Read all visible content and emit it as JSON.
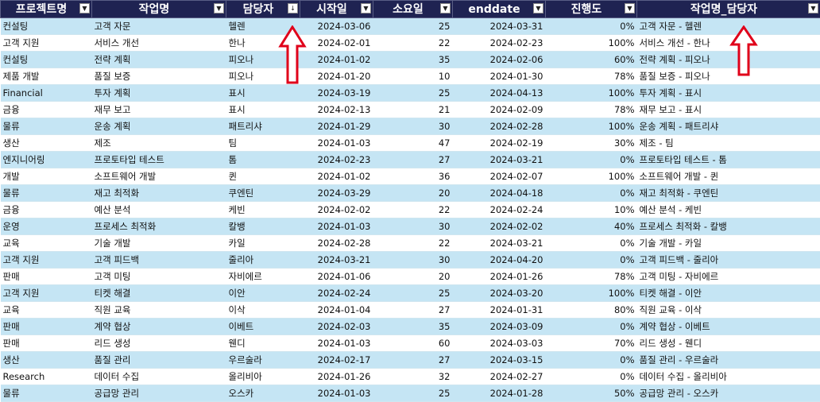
{
  "headers": [
    {
      "label": "프로젝트명",
      "filter_icon": "▼"
    },
    {
      "label": "작업명",
      "filter_icon": "▼"
    },
    {
      "label": "담당자",
      "filter_icon": "↓"
    },
    {
      "label": "시작일",
      "filter_icon": "▼"
    },
    {
      "label": "소요일",
      "filter_icon": "▼"
    },
    {
      "label": "enddate",
      "filter_icon": "▼"
    },
    {
      "label": "진행도",
      "filter_icon": "▼"
    },
    {
      "label": "작업명_담당자",
      "filter_icon": "▼"
    }
  ],
  "rows": [
    [
      "컨설팅",
      "고객 자문",
      "헬렌",
      "2024-03-06",
      "25",
      "2024-03-31",
      "0%",
      "고객 자문 - 헬렌"
    ],
    [
      "고객 지원",
      "서비스 개선",
      "한나",
      "2024-02-01",
      "22",
      "2024-02-23",
      "100%",
      "서비스 개선 - 한나"
    ],
    [
      "컨설팅",
      "전략 계획",
      "피오나",
      "2024-01-02",
      "35",
      "2024-02-06",
      "60%",
      "전략 계획 - 피오나"
    ],
    [
      "제품 개발",
      "품질 보증",
      "피오나",
      "2024-01-20",
      "10",
      "2024-01-30",
      "78%",
      "품질 보증 - 피오나"
    ],
    [
      "Financial",
      "투자 계획",
      "표시",
      "2024-03-19",
      "25",
      "2024-04-13",
      "100%",
      "투자 계획 - 표시"
    ],
    [
      "금융",
      "재무 보고",
      "표시",
      "2024-02-13",
      "21",
      "2024-02-09",
      "78%",
      "재무 보고 - 표시"
    ],
    [
      "물류",
      "운송 계획",
      "패트리샤",
      "2024-01-29",
      "30",
      "2024-02-28",
      "100%",
      "운송 계획 - 패트리샤"
    ],
    [
      "생산",
      "제조",
      "팀",
      "2024-01-03",
      "47",
      "2024-02-19",
      "30%",
      "제조 - 팀"
    ],
    [
      "엔지니어링",
      "프로토타입 테스트",
      "톰",
      "2024-02-23",
      "27",
      "2024-03-21",
      "0%",
      "프로토타입 테스트 - 톰"
    ],
    [
      "개발",
      "소프트웨어 개발",
      "퀸",
      "2024-01-02",
      "36",
      "2024-02-07",
      "100%",
      "소프트웨어 개발 - 퀸"
    ],
    [
      "물류",
      "재고 최적화",
      "쿠엔틴",
      "2024-03-29",
      "20",
      "2024-04-18",
      "0%",
      "재고 최적화 - 쿠엔틴"
    ],
    [
      "금융",
      "예산 분석",
      "케빈",
      "2024-02-02",
      "22",
      "2024-02-24",
      "10%",
      "예산 분석 - 케빈"
    ],
    [
      "운영",
      "프로세스 최적화",
      "칼뱅",
      "2024-01-03",
      "30",
      "2024-02-02",
      "40%",
      "프로세스 최적화 - 칼뱅"
    ],
    [
      "교육",
      "기술 개발",
      "카일",
      "2024-02-28",
      "22",
      "2024-03-21",
      "0%",
      "기술 개발 - 카일"
    ],
    [
      "고객 지원",
      "고객 피드백",
      "줄리아",
      "2024-03-21",
      "30",
      "2024-04-20",
      "0%",
      "고객 피드백 - 줄리아"
    ],
    [
      "판매",
      "고객 미팅",
      "자비에르",
      "2024-01-06",
      "20",
      "2024-01-26",
      "78%",
      "고객 미팅 - 자비에르"
    ],
    [
      "고객 지원",
      "티켓 해결",
      "이안",
      "2024-02-24",
      "25",
      "2024-03-20",
      "100%",
      "티켓 해결 - 이안"
    ],
    [
      "교육",
      "직원 교육",
      "이삭",
      "2024-01-04",
      "27",
      "2024-01-31",
      "80%",
      "직원 교육 - 이삭"
    ],
    [
      "판매",
      "계약 협상",
      "이베트",
      "2024-02-03",
      "35",
      "2024-03-09",
      "0%",
      "계약 협상 - 이베트"
    ],
    [
      "판매",
      "리드 생성",
      "웬디",
      "2024-01-03",
      "60",
      "2024-03-03",
      "70%",
      "리드 생성 - 웬디"
    ],
    [
      "생산",
      "품질 관리",
      "우르술라",
      "2024-02-17",
      "27",
      "2024-03-15",
      "0%",
      "품질 관리 - 우르술라"
    ],
    [
      "Research",
      "데이터 수집",
      "올리비아",
      "2024-01-26",
      "32",
      "2024-02-27",
      "0%",
      "데이터 수집 - 올리비아"
    ],
    [
      "물류",
      "공급망 관리",
      "오스카",
      "2024-01-03",
      "25",
      "2024-01-28",
      "50%",
      "공급망 관리 - 오스카"
    ]
  ],
  "colors": {
    "header_bg": "#1f2352",
    "stripe": "#c5e5f4",
    "annotation_arrow": "#e0001a"
  }
}
